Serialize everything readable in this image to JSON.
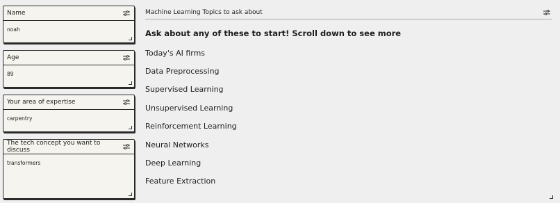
{
  "fields": [
    {
      "label": "Name",
      "value": "noah"
    },
    {
      "label": "Age",
      "value": "89"
    },
    {
      "label": "Your area of expertise",
      "value": "carpentry"
    },
    {
      "label": "The tech concept you want to discuss",
      "value": "transformers"
    }
  ],
  "panel": {
    "title": "Machine Learning Topics to ask about",
    "intro": "Ask about any of these to start! Scroll down to see more",
    "topics": [
      "Today's AI firms",
      "Data Preprocessing",
      "Supervised Learning",
      "Unsupervised Learning",
      "Reinforcement Learning",
      "Neural Networks",
      "Deep Learning",
      "Feature Extraction"
    ]
  },
  "icons": {
    "settings": "sliders-icon",
    "resize": "resize-grip-icon"
  }
}
